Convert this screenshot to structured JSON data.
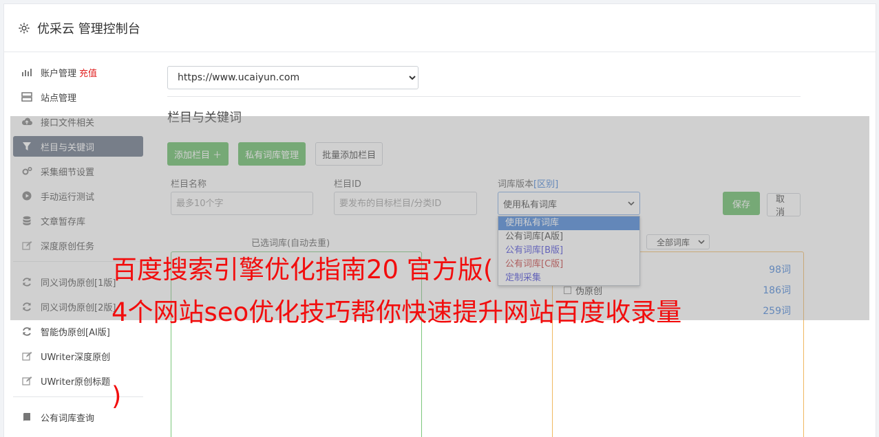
{
  "header": {
    "title": "优采云 管理控制台"
  },
  "sidebar": {
    "items": [
      {
        "label": "账户管理",
        "extra": "充值",
        "icon": "bar-chart-icon"
      },
      {
        "label": "站点管理",
        "icon": "server-icon"
      },
      {
        "label": "接口文件相关",
        "icon": "cloud-upload-icon"
      },
      {
        "label": "栏目与关键词",
        "icon": "filter-icon",
        "active": true
      },
      {
        "label": "采集细节设置",
        "icon": "cogs-icon"
      },
      {
        "label": "手动运行测试",
        "icon": "play-circle-icon"
      },
      {
        "label": "文章暂存库",
        "icon": "database-icon"
      },
      {
        "label": "深度原创任务",
        "icon": "edit-icon"
      }
    ],
    "items2": [
      {
        "label": "同义词伪原创[1版]",
        "icon": "refresh-icon"
      },
      {
        "label": "同义词伪原创[2版]",
        "icon": "refresh-icon"
      },
      {
        "label": "智能伪原创[AI版]",
        "icon": "refresh-icon"
      },
      {
        "label": "UWriter深度原创",
        "icon": "edit-icon"
      },
      {
        "label": "UWriter原创标题",
        "icon": "edit-icon"
      }
    ],
    "items3": [
      {
        "label": "公有词库查询",
        "icon": "book-icon"
      }
    ]
  },
  "main": {
    "site_select": "https://www.ucaiyun.com",
    "section_title": "栏目与关键词",
    "buttons": {
      "add_column": "添加栏目 ＋",
      "private_lib": "私有词库管理",
      "batch_add": "批量添加栏目"
    },
    "form": {
      "name_label": "栏目名称",
      "name_placeholder": "最多10个字",
      "id_label": "栏目ID",
      "id_placeholder": "要发布的目标栏目/分类ID",
      "version_label": "词库版本",
      "version_link": "[区别]",
      "version_value": "使用私有词库",
      "save": "保存",
      "cancel": "取消"
    },
    "dropdown": [
      "使用私有词库",
      "公有词库[A版]",
      "公有词库[B版]",
      "公有词库[C版]",
      "定制采集"
    ],
    "chosen_label": "已选词库(自动去重)",
    "all_lib": "全部词库",
    "libs": [
      {
        "name": "",
        "count": "98词"
      },
      {
        "name": "伪原创",
        "count": "186词"
      },
      {
        "name": "",
        "count": "259词"
      }
    ]
  },
  "watermark": {
    "line1": "百度搜索引擎优化指南20 官方版(",
    "line2": "4个网站seo优化技巧帮你快速提升网站百度收录量",
    "line3": ")"
  },
  "colors": {
    "accent_green": "#5cb85c",
    "active_nav": "#5d6a7e",
    "link_blue": "#3a7bd5",
    "watermark_red": "#f20d0d"
  }
}
